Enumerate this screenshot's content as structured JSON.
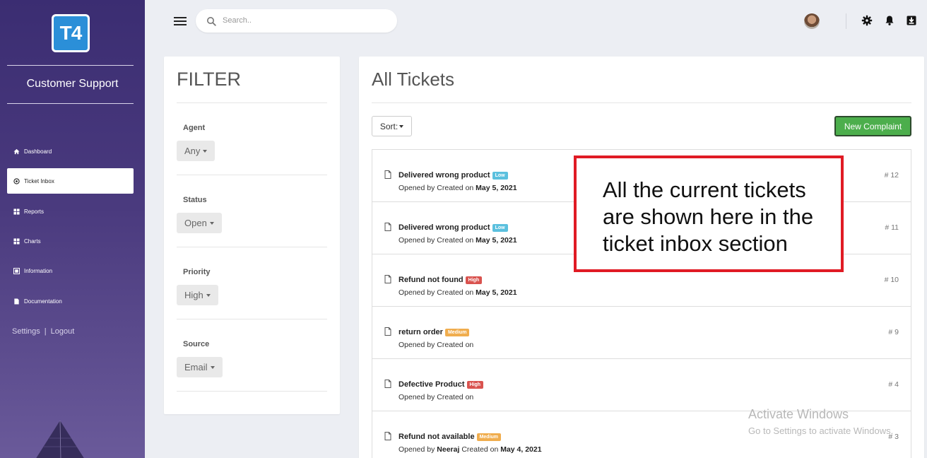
{
  "sidebar": {
    "logo_text": "T4",
    "brand_title": "Customer Support",
    "items": [
      {
        "label": "Dashboard",
        "icon": "home-icon"
      },
      {
        "label": "Ticket Inbox",
        "icon": "inbox-icon",
        "active": true
      },
      {
        "label": "Reports",
        "icon": "grid-icon"
      },
      {
        "label": "Charts",
        "icon": "grid-icon"
      },
      {
        "label": "Information",
        "icon": "info-grid-icon"
      },
      {
        "label": "Documentation",
        "icon": "document-icon"
      }
    ],
    "settings_label": "Settings",
    "separator": "|",
    "logout_label": "Logout"
  },
  "header": {
    "search_placeholder": "Search..",
    "icons": [
      "menu-icon",
      "search-icon",
      "avatar",
      "gear-icon",
      "bell-icon",
      "download-icon"
    ]
  },
  "filter": {
    "title": "FILTER",
    "agent": {
      "label": "Agent",
      "value": "Any"
    },
    "status": {
      "label": "Status",
      "value": "Open"
    },
    "priority": {
      "label": "Priority",
      "value": "High"
    },
    "source": {
      "label": "Source",
      "value": "Email"
    }
  },
  "tickets": {
    "title": "All Tickets",
    "sort_label": "Sort:",
    "new_label": "New Complaint",
    "priority_colors": {
      "Low": "#5bc0de",
      "High": "#d9534f",
      "Medium": "#f0ad4e"
    },
    "items": [
      {
        "subject": "Delivered wrong product",
        "priority": "Low",
        "meta_prefix": "Opened by",
        "creator": "",
        "meta_mid": "Created on",
        "date": "May 5, 2021",
        "number": "# 12"
      },
      {
        "subject": "Delivered wrong product",
        "priority": "Low",
        "meta_prefix": "Opened by",
        "creator": "",
        "meta_mid": "Created on",
        "date": "May 5, 2021",
        "number": "# 11"
      },
      {
        "subject": "Refund not found",
        "priority": "High",
        "meta_prefix": "Opened by",
        "creator": "",
        "meta_mid": "Created on",
        "date": "May 5, 2021",
        "number": "# 10"
      },
      {
        "subject": "return order",
        "priority": "Medium",
        "meta_prefix": "Opened by",
        "creator": "",
        "meta_mid": "Created on",
        "date": "",
        "number": "# 9"
      },
      {
        "subject": "Defective Product",
        "priority": "High",
        "meta_prefix": "Opened by",
        "creator": "",
        "meta_mid": "Created on",
        "date": "",
        "number": "# 4"
      },
      {
        "subject": "Refund not available",
        "priority": "Medium",
        "meta_prefix": "Opened by",
        "creator": "Neeraj",
        "meta_mid": "Created on",
        "date": "May 4, 2021",
        "number": "# 3"
      }
    ]
  },
  "annotation": {
    "lines": [
      "All the current tickets",
      "are shown here in the",
      "ticket inbox section"
    ],
    "border_color": "#e01b24"
  },
  "watermark": {
    "line1": "Activate Windows",
    "line2": "Go to Settings to activate Windows."
  }
}
